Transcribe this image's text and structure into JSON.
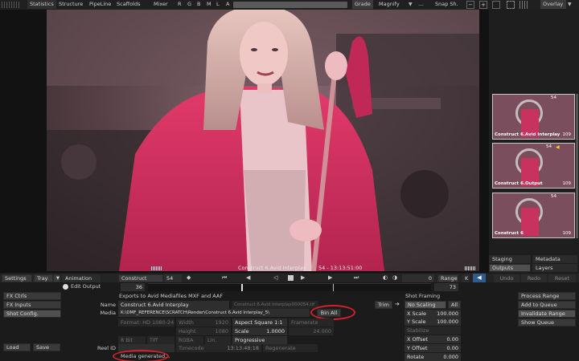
{
  "toolbar": {
    "statistics": "Statistics",
    "structure": "Structure",
    "pipeline": "PipeLine",
    "scaffolds": "Scaffolds",
    "mixer": "Mixer",
    "channels": [
      "R",
      "G",
      "B",
      "M",
      "L",
      "A"
    ],
    "grade": "Grade",
    "magnify": "Magnify",
    "snapshot": "Snap Sh.",
    "overlay": "Overlay"
  },
  "viewer": {
    "caption": "Construct 6.Avid Interplay",
    "timecode": "54 - 13:13:51:00"
  },
  "thumbnails": [
    {
      "title": "Construct 6.Avid Interplay",
      "num": "54",
      "count": "109"
    },
    {
      "title": "Construct 6.Output",
      "num": "54",
      "count": "109"
    },
    {
      "title": "Construct 6",
      "num": "54",
      "count": "109"
    }
  ],
  "right_tabs": {
    "staging": "Staging",
    "metadata": "Metadata",
    "outputs": "Outputs",
    "layers": "Layers"
  },
  "transport": {
    "settings": "Settings",
    "tray": "Tray",
    "animation": "Animation",
    "construct": "Construct",
    "frame": "54",
    "zero": "0",
    "range": "Range",
    "k": "K",
    "undo": "Undo",
    "redo": "Redo",
    "reset": "Reset",
    "edit_output": "Edit Output",
    "start": "36",
    "end": "73"
  },
  "left_buttons": {
    "fx_ctrls": "FX Ctrls",
    "fx_inputs": "FX Inputs",
    "shot_config": "Shot Config.",
    "load": "Load",
    "save": "Save"
  },
  "form": {
    "heading": "Exports to Avid Mediafiles MXF and AAF",
    "name_label": "Name",
    "name_value": "Construct 6.Avid Interplay",
    "name_file": "Construct 6.Avid Interplay000054.tif",
    "media_label": "Media",
    "media_path": "K:\\DMF_REFERENCE\\SCRATCH\\Render\\Construct 6.Avid Interplay_5\\",
    "bin_all": "Bin All",
    "format": "Format: HD 1080-24",
    "width_label": "Width",
    "width_value": "1920",
    "height_label": "Height",
    "height_value": "1080",
    "aspect": "Aspect Square 1:1",
    "framerate_label": "Framerate",
    "framerate_value": "24.000",
    "scale_label": "Scale",
    "scale_value": "1.0000",
    "bit": "8 Bit",
    "tiff": "Tiff",
    "rgba": "RGBA",
    "lin": "Lin.",
    "progressive": "Progressive",
    "reel_label": "Reel ID",
    "timecode_label": "Timecode",
    "timecode_value": "13:13:48:18",
    "regenerate": "Regenerate",
    "media_generated": "Media generated..."
  },
  "framing": {
    "heading": "Shot Framing",
    "trim": "Trim",
    "no_scaling": "No Scaling",
    "all": "All",
    "x_scale_label": "X Scale",
    "x_scale": "100.000",
    "y_scale_label": "Y Scale",
    "y_scale": "100.000",
    "stabilize": "Stabilize",
    "x_offset_label": "X Offset",
    "x_offset": "0.00",
    "y_offset_label": "Y Offset",
    "y_offset": "0.00",
    "rotate_label": "Rotate",
    "rotate": "0.000"
  },
  "right_actions": {
    "process_range": "Process Range",
    "add_to_queue": "Add to Queue",
    "invalidate_range": "Invalidate Range",
    "show_queue": "Show Queue"
  },
  "colors": {
    "accent_red": "#d4202a",
    "panel": "#1b1b1b",
    "viewer_tint": "#d08aa0"
  }
}
